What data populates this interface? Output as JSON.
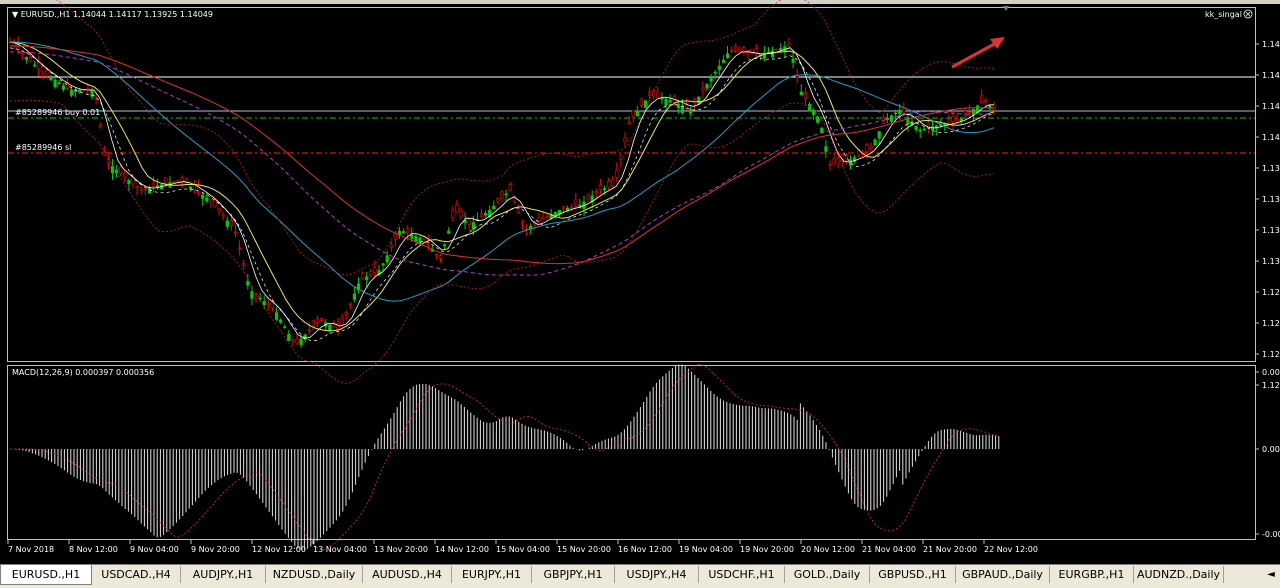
{
  "window": {
    "title": "EURUSD.,H1",
    "ohlc": "1.14044 1.14117 1.13925 1.14049",
    "indicator_name": "kk_singal"
  },
  "orders": {
    "buy_label": "#85289946 buy 0.01",
    "sl_label": "#85289946 sl"
  },
  "price_axis": [
    "1.14",
    "1.14",
    "1.14",
    "1.14",
    "1.13",
    "1.13",
    "1.13",
    "1.13",
    "1.12",
    "1.12",
    "1.12",
    "1.12"
  ],
  "macd": {
    "label": "MACD(12,26,9) 0.000397 0.000356",
    "axis": [
      "0.00",
      "0.00",
      "-0.00"
    ]
  },
  "time_axis": [
    "7 Nov 2018",
    "8 Nov 12:00",
    "9 Nov 04:00",
    "9 Nov 20:00",
    "12 Nov 12:00",
    "13 Nov 04:00",
    "13 Nov 20:00",
    "14 Nov 12:00",
    "15 Nov 04:00",
    "15 Nov 20:00",
    "16 Nov 12:00",
    "19 Nov 04:00",
    "19 Nov 20:00",
    "20 Nov 12:00",
    "21 Nov 04:00",
    "21 Nov 20:00",
    "22 Nov 12:00"
  ],
  "tabs": [
    "EURUSD.,H1",
    "USDCAD.,H4",
    "AUDJPY.,H1",
    "NZDUSD.,Daily",
    "AUDUSD.,H4",
    "EURJPY.,H1",
    "GBPJPY.,H1",
    "USDJPY.,H4",
    "USDCHF.,H1",
    "GOLD.,Daily",
    "GBPUSD.,H1",
    "GBPAUD.,Daily",
    "EURGBP.,H1",
    "AUDNZD.,Daily"
  ],
  "tab_scroll_icon": "triangle-left-icon",
  "colors": {
    "background": "#000000",
    "bull": "#00cc00",
    "bear": "#ff0000",
    "grid": "#00ff00",
    "arrow": "#e33030"
  }
}
